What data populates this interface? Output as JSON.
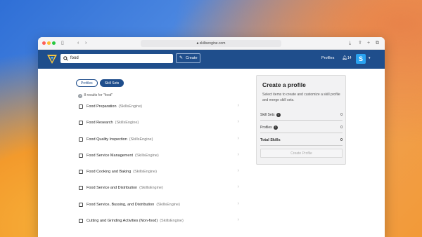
{
  "browser": {
    "url": "skillsengine.com",
    "icons": [
      "sidebar-icon",
      "back-icon",
      "forward-icon",
      "download-icon",
      "share-icon",
      "new-tab-icon",
      "tabs-icon"
    ]
  },
  "header": {
    "search_value": "food",
    "create_label": "Create",
    "profiles_label": "Profiles",
    "notification_count": "14",
    "avatar_letter": "S",
    "colors": {
      "navbar": "#1f4e8c",
      "avatar": "#2aa3f0"
    }
  },
  "tabs": [
    {
      "label": "Profiles",
      "active": false
    },
    {
      "label": "Skill Sets",
      "active": true
    }
  ],
  "results_info": "8 results for \"food\"",
  "results": [
    {
      "title": "Food Preparation",
      "source": "(SkillsEngine)"
    },
    {
      "title": "Food Research",
      "source": "(SkillsEngine)"
    },
    {
      "title": "Food Quality Inspection",
      "source": "(SkillsEngine)"
    },
    {
      "title": "Food Service Management",
      "source": "(SkillsEngine)"
    },
    {
      "title": "Food Cooking and Baking",
      "source": "(SkillsEngine)"
    },
    {
      "title": "Food Service and Distribution",
      "source": "(SkillsEngine)"
    },
    {
      "title": "Food Service, Bussing, and Distribution",
      "source": "(SkillsEngine)"
    },
    {
      "title": "Cutting and Grinding Activities (Non-food)",
      "source": "(SkillsEngine)"
    }
  ],
  "panel": {
    "title": "Create a profile",
    "description": "Select items to create and customize a skill profile and merge skill sets.",
    "skill_sets_label": "Skill Sets",
    "skill_sets_value": "0",
    "profiles_label": "Profiles",
    "profiles_value": "0",
    "total_label": "Total Skills",
    "total_value": "0",
    "button_label": "Create Profile"
  }
}
